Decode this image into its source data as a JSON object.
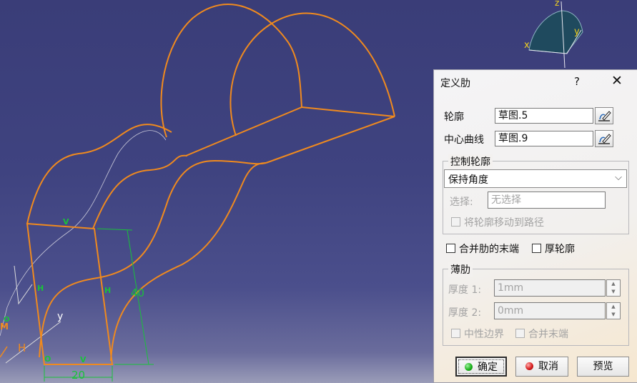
{
  "viewport": {
    "labels": {
      "v_top": "V",
      "h_left": "H",
      "h_right": "H",
      "dim_vertical": "40",
      "dim_horizontal": "20",
      "o_bottom": "O",
      "v_bottom": "V",
      "axis_y": "y",
      "axis_h": "H",
      "o_left": "O",
      "m_left": "M"
    },
    "compass": {
      "z": "z",
      "x": "x",
      "y": "y"
    },
    "colors": {
      "geometry": "#f08a1e",
      "dimension": "#19c23a",
      "sketch": "#c8c8d8",
      "compass_fill": "#1f4a5e",
      "compass_axis": "#f0d020"
    }
  },
  "dialog": {
    "title": "定义肋",
    "help": "?",
    "close": "✕",
    "profile_label": "轮廓",
    "profile_value": "草图.5",
    "center_curve_label": "中心曲线",
    "center_curve_value": "草图.9",
    "control_group": {
      "title": "控制轮廓",
      "mode_value": "保持角度",
      "select_label": "选择:",
      "select_placeholder": "无选择",
      "move_profile_label": "将轮廓移动到路径"
    },
    "merge_ends_label": "合并肋的末端",
    "thick_profile_label": "厚轮廓",
    "thin_group": {
      "title": "薄肋",
      "thickness1_label": "厚度 1:",
      "thickness1_value": "1mm",
      "thickness2_label": "厚度 2:",
      "thickness2_value": "0mm",
      "neutral_label": "中性边界",
      "merge_label": "合并末端"
    },
    "buttons": {
      "ok": "确定",
      "cancel": "取消",
      "preview": "预览"
    },
    "colors": {
      "ok_dot": "#1db31d",
      "cancel_dot": "#d81e1e"
    }
  }
}
